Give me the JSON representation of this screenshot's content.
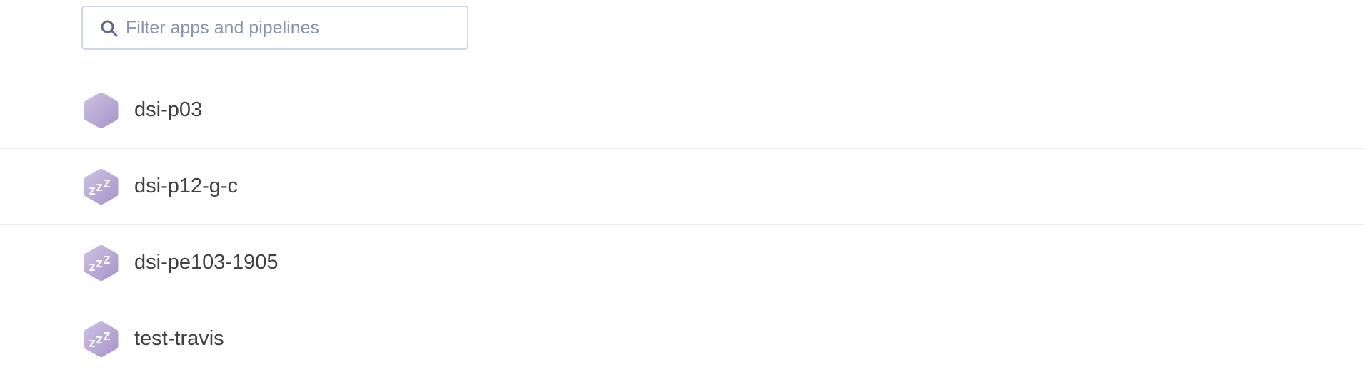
{
  "filter": {
    "placeholder": "Filter apps and pipelines",
    "value": "",
    "icon": "search-icon"
  },
  "apps": [
    {
      "name": "dsi-p03",
      "icon": "app-hexagon-icon",
      "sleeping": false
    },
    {
      "name": "dsi-p12-g-c",
      "icon": "app-sleeping-icon",
      "sleeping": true
    },
    {
      "name": "dsi-pe103-1905",
      "icon": "app-sleeping-icon",
      "sleeping": true
    },
    {
      "name": "test-travis",
      "icon": "app-sleeping-icon",
      "sleeping": true
    }
  ],
  "colors": {
    "hex_light": "#c9bde0",
    "hex_dark": "#a593c9",
    "text": "#3f3f44",
    "placeholder": "#8a95a8",
    "border": "#cfd7e6",
    "divider": "#e8ebf0"
  }
}
